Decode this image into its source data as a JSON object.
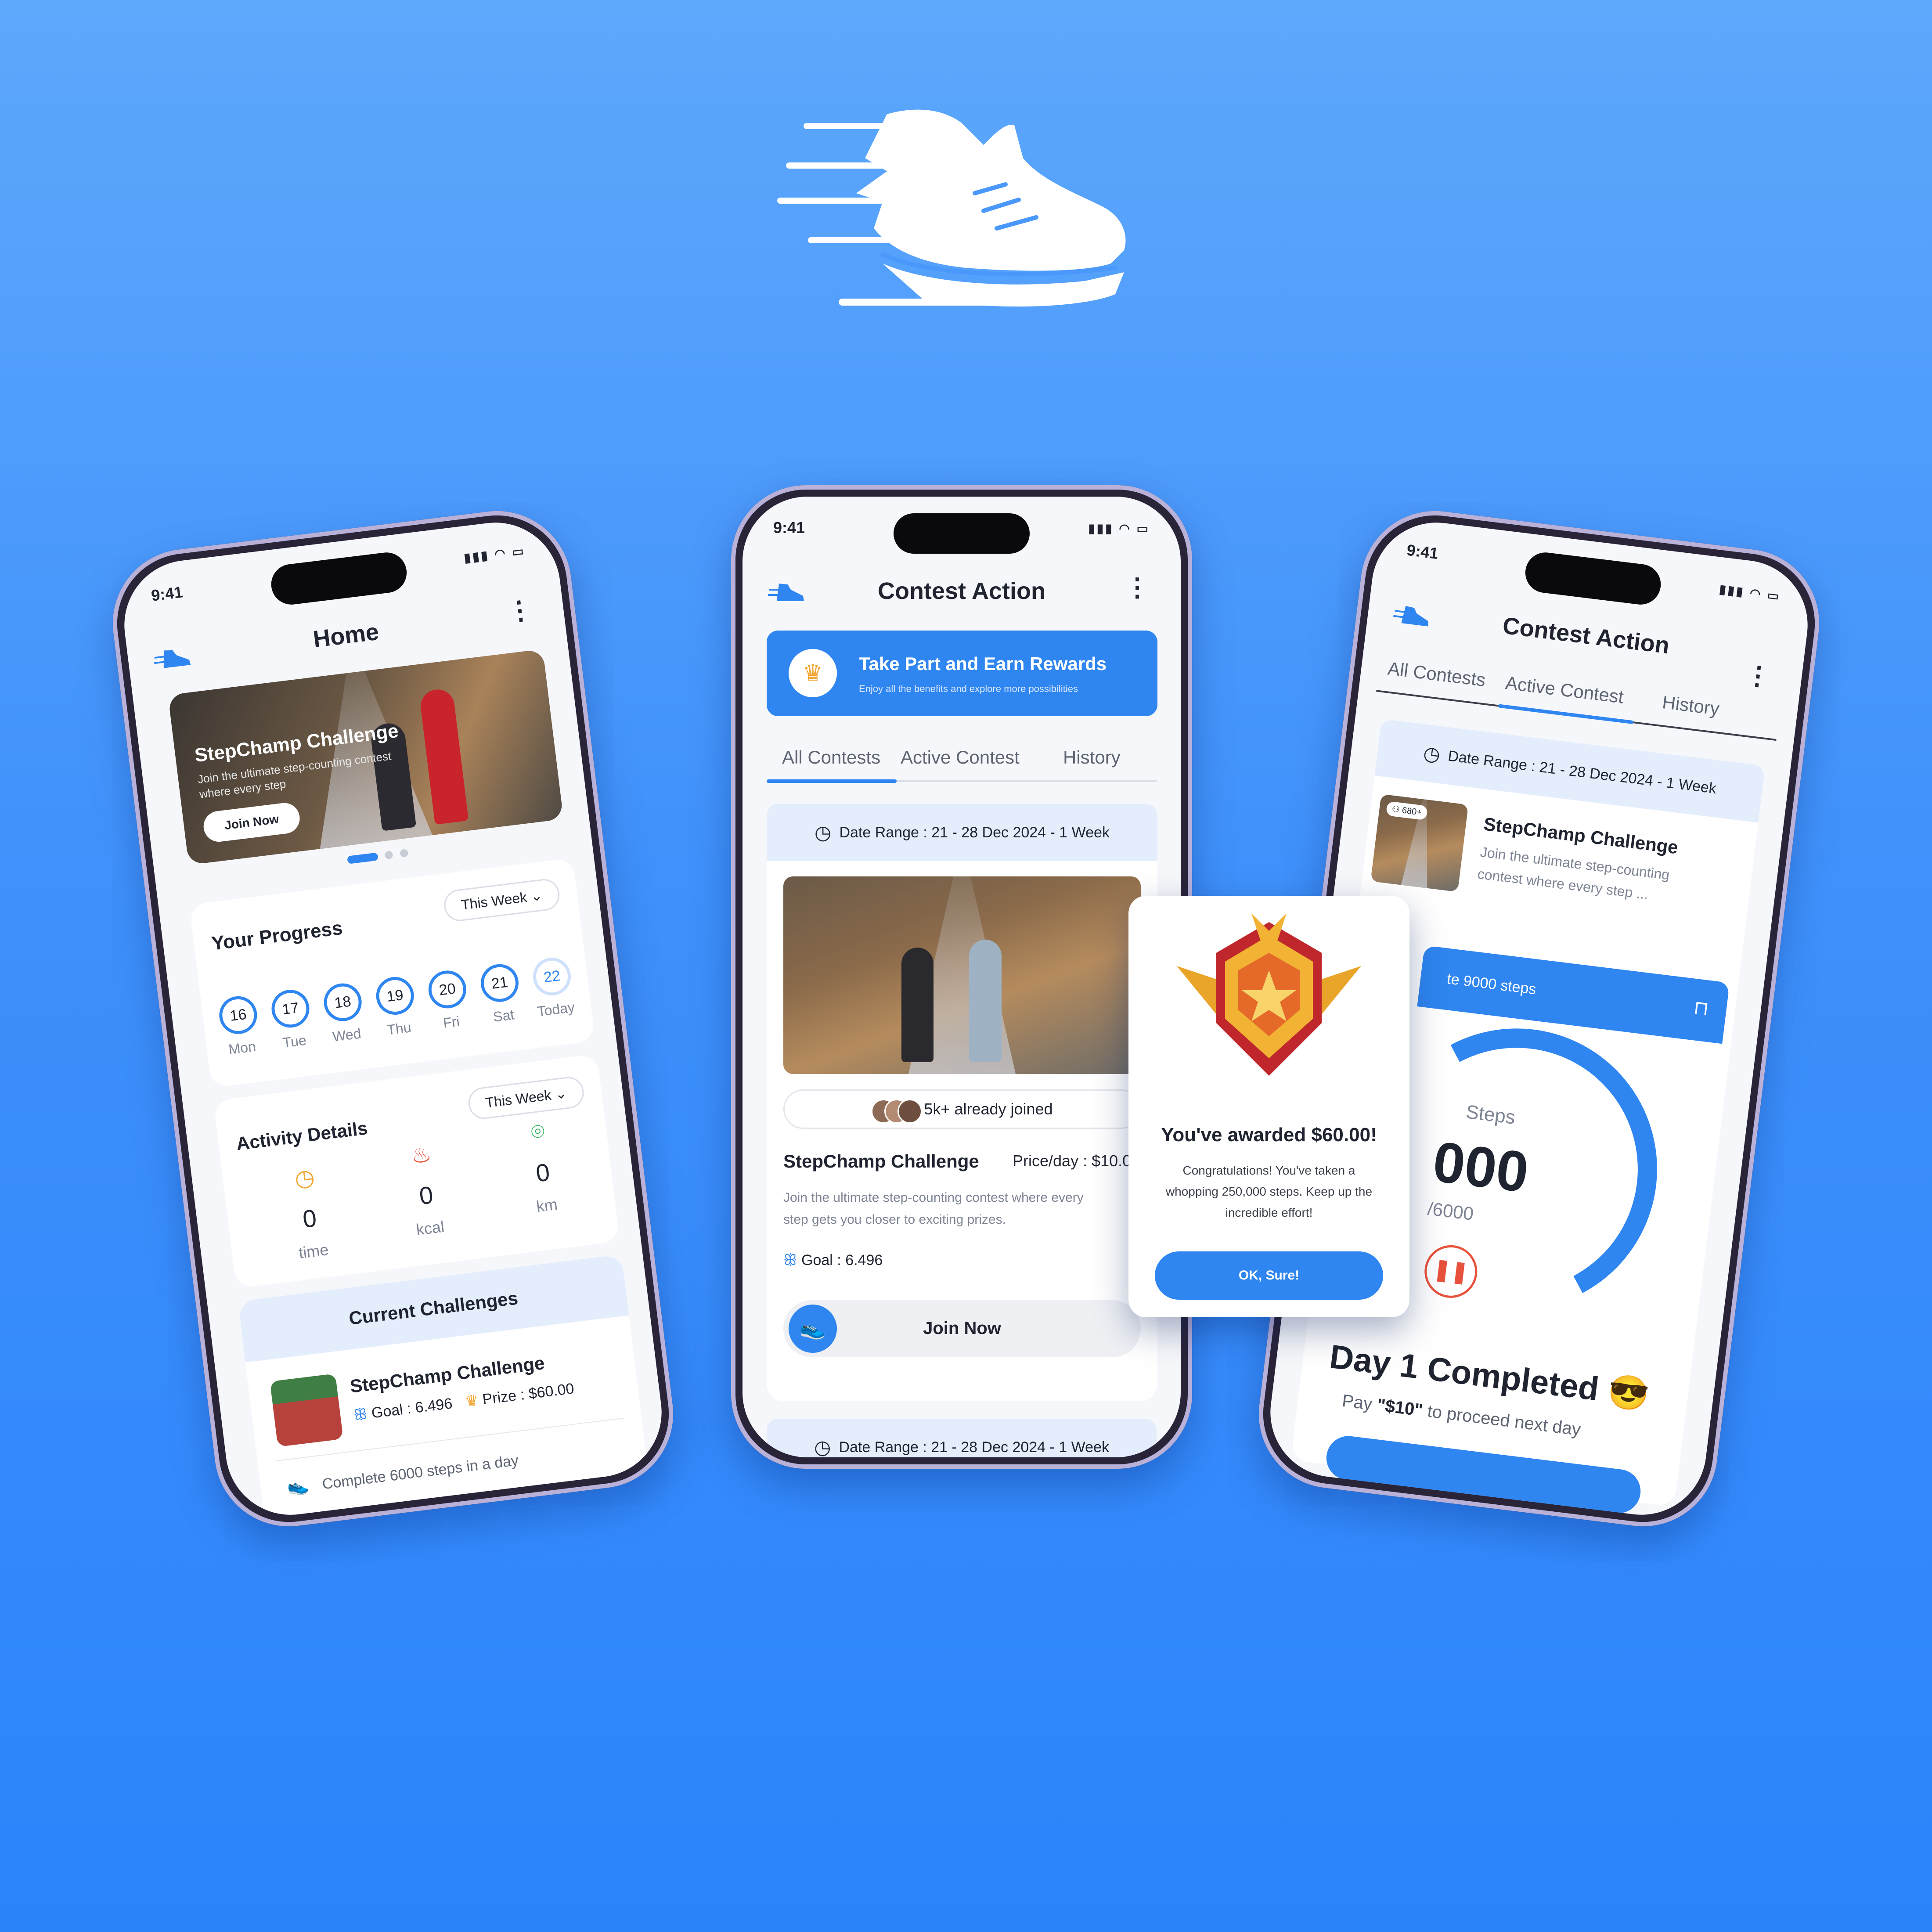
{
  "brand": {
    "accent": "#2f86f0",
    "background": "#3f91fb",
    "logo_icon": "running-shoe-icon"
  },
  "phone_left": {
    "time": "9:41",
    "title": "Home",
    "banner": {
      "title": "StepChamp Challenge",
      "subtitle_line1": "Join the ultimate step-counting contest",
      "subtitle_line2": "where every step",
      "cta": "Join Now"
    },
    "progress": {
      "title": "Your Progress",
      "filter": "This Week",
      "days": [
        {
          "num": "16",
          "label": "Mon"
        },
        {
          "num": "17",
          "label": "Tue"
        },
        {
          "num": "18",
          "label": "Wed"
        },
        {
          "num": "19",
          "label": "Thu"
        },
        {
          "num": "20",
          "label": "Fri"
        },
        {
          "num": "21",
          "label": "Sat"
        },
        {
          "num": "22",
          "label": "Today"
        }
      ]
    },
    "activity": {
      "title": "Activity Details",
      "filter": "This Week",
      "stats": [
        {
          "icon": "clock-icon",
          "value": "0",
          "unit": "time"
        },
        {
          "icon": "flame-icon",
          "value": "0",
          "unit": "kcal"
        },
        {
          "icon": "location-pin-icon",
          "value": "0",
          "unit": "km"
        }
      ]
    },
    "current": {
      "title": "Current Challenges",
      "name": "StepChamp Challenge",
      "goal_label": "Goal :",
      "goal": "6.496",
      "prize_label": "Prize :",
      "prize": "$60.00",
      "footer": "Complete 6000 steps in a day"
    }
  },
  "phone_center": {
    "time": "9:41",
    "title": "Contest Action",
    "rewards": {
      "title": "Take Part and Earn Rewards",
      "subtitle": "Enjoy all the benefits and explore more possibilities"
    },
    "tabs": [
      "All Contests",
      "Active Contest",
      "History"
    ],
    "active_tab": 0,
    "date_range": "Date Range : 21 - 28 Dec 2024  -  1 Week",
    "joined": "5k+ already joined",
    "challenge": {
      "name": "StepChamp Challenge",
      "price": "Price/day : $10.0",
      "desc_line1": "Join the ultimate step-counting contest where every",
      "desc_line2": "step gets you closer to exciting prizes.",
      "goal_label": "Goal :",
      "goal": "6.496",
      "cta": "Join Now"
    },
    "date_range_2": "Date Range : 21 - 28 Dec 2024  -  1 Week"
  },
  "phone_right": {
    "time": "9:41",
    "title": "Contest Action",
    "tabs": [
      "All Contests",
      "Active Contest",
      "History"
    ],
    "active_tab": 1,
    "date_range": "Date Range : 21 - 28 Dec 2024  -  1 Week",
    "thumb_badge": "680+",
    "challenge": {
      "name": "StepChamp Challenge",
      "desc_line1": "Join the ultimate step-counting",
      "desc_line2": "contest where every step ..."
    },
    "task": "te 9000 steps",
    "gauge": {
      "label": "Steps",
      "value": "000",
      "target": "/6000",
      "progress": 0.62
    },
    "completed": "Day 1 Completed",
    "completed_emoji": "😎",
    "pay_prefix": "Pay",
    "pay_amount": "\"$10\"",
    "pay_suffix": "to proceed next day"
  },
  "modal": {
    "title": "You've awarded $60.00!",
    "body_line1": "Congratulations! You've taken a",
    "body_line2": "whopping 250,000 steps. Keep up the",
    "body_line3": "incredible effort!",
    "cta": "OK, Sure!"
  }
}
